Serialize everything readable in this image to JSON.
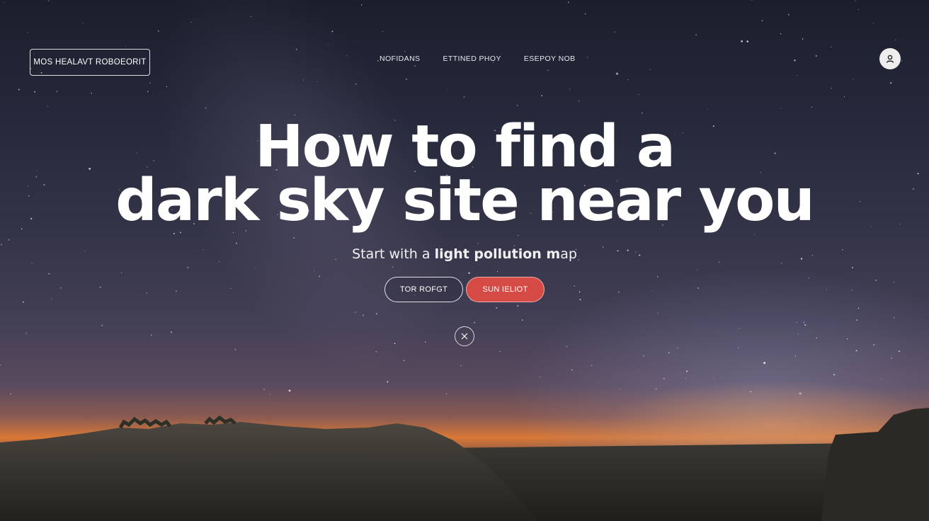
{
  "header": {
    "brand_button": "MOS HEALAVT ROBOEORIT",
    "nav": [
      "NOFIDANS",
      "ETTINED PHOY",
      "ESEPOY NOB"
    ],
    "avatar_icon": "user-icon"
  },
  "hero": {
    "title_line1": "How to find a",
    "title_line2": "dark sky site near you",
    "subtitle_prefix": "Start with a ",
    "subtitle_bold": "light pollution m",
    "subtitle_suffix": "ap"
  },
  "cta": {
    "secondary_label": "TOR ROFGT",
    "primary_label": "SUN IELIOT"
  },
  "close_icon": "close-icon",
  "colors": {
    "primary_button": "#d64a45",
    "sky_top": "#1b1e2c",
    "horizon_glow": "#d97836"
  }
}
